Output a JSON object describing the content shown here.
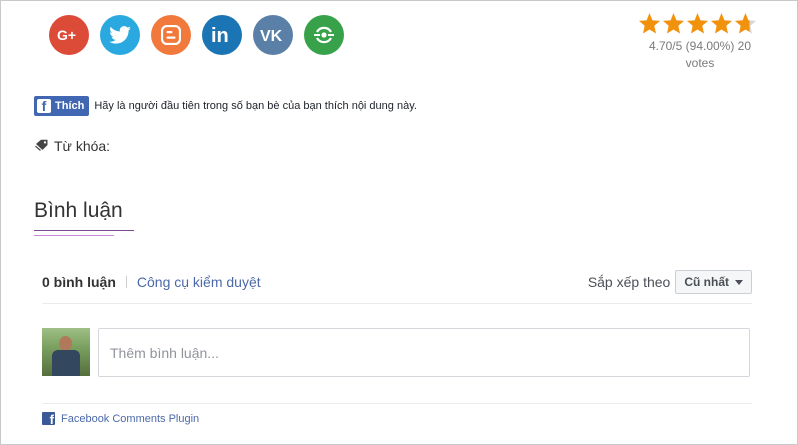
{
  "social": {
    "buttons": [
      {
        "name": "google-plus",
        "icon": "google-plus-icon",
        "color": "#dc4a38",
        "glyph": "G+"
      },
      {
        "name": "twitter",
        "icon": "twitter-bird-icon",
        "color": "#2aa9e0"
      },
      {
        "name": "blogger",
        "icon": "blogger-icon",
        "color": "#f1793b"
      },
      {
        "name": "linkedin",
        "icon": "linkedin-icon",
        "color": "#1b75b4",
        "glyph": "in"
      },
      {
        "name": "vk",
        "icon": "vk-icon",
        "color": "#5b80a7",
        "glyph": "VK"
      },
      {
        "name": "share",
        "icon": "share-target-icon",
        "color": "#37a24a"
      }
    ]
  },
  "rating": {
    "score": 4.7,
    "max": 5,
    "star_color": "#f2920c",
    "text_line1": "4.70/5 (94.00%) 20",
    "text_line2": "votes"
  },
  "facebook_like": {
    "button_label": "Thích",
    "message": "Hãy là người đầu tiên trong số bạn bè của bạn thích nội dung này."
  },
  "keywords": {
    "icon": "tag-icon",
    "label": "Từ khóa:"
  },
  "comments": {
    "title": "Bình luận",
    "count_label": "0 bình luận",
    "moderation_label": "Công cụ kiểm duyệt",
    "sort_label": "Sắp xếp theo",
    "sort_selected": "Cũ nhất",
    "input_placeholder": "Thêm bình luận...",
    "plugin_label": "Facebook Comments Plugin"
  }
}
